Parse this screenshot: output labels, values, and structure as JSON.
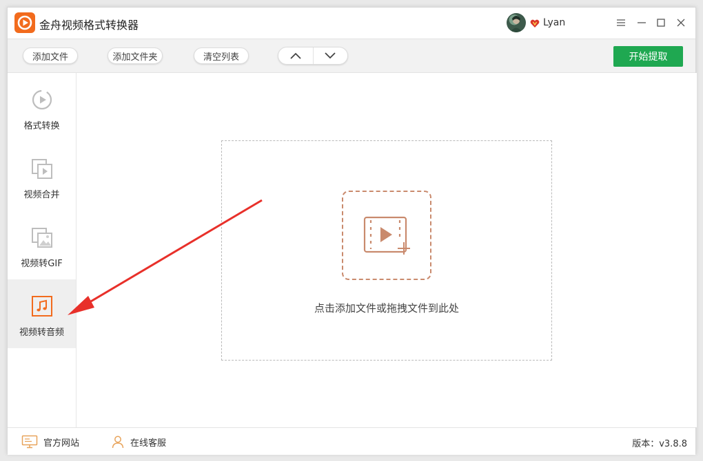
{
  "app": {
    "title": "金舟视频格式转换器",
    "logo_icon": "play-circle-logo-icon",
    "accent_color": "#f26b1d"
  },
  "user": {
    "name": "Lyan",
    "vip_icon": "vip-heart-icon"
  },
  "window_controls": [
    "menu-icon",
    "minimize-icon",
    "maximize-icon",
    "close-icon"
  ],
  "toolbar": {
    "add_file": "添加文件",
    "add_folder": "添加文件夹",
    "clear_list": "清空列表",
    "move_up_icon": "chevron-up-icon",
    "move_down_icon": "chevron-down-icon",
    "start": "开始提取",
    "start_color": "#1fa851"
  },
  "sidebar": {
    "items": [
      {
        "label": "格式转换",
        "icon": "format-convert-icon",
        "active": false
      },
      {
        "label": "视频合并",
        "icon": "video-merge-icon",
        "active": false
      },
      {
        "label": "视频转GIF",
        "icon": "video-to-gif-icon",
        "active": false
      },
      {
        "label": "视频转音频",
        "icon": "music-note-icon",
        "active": true
      }
    ]
  },
  "main": {
    "drop_icon": "add-video-icon",
    "drop_text": "点击添加文件或拖拽文件到此处"
  },
  "statusbar": {
    "website": "官方网站",
    "website_icon": "monitor-icon",
    "support": "在线客服",
    "support_icon": "person-icon",
    "version": "版本：v3.8.8"
  },
  "annotation": {
    "arrow_color": "#e8302a",
    "target": "sidebar-item-video-to-audio"
  }
}
